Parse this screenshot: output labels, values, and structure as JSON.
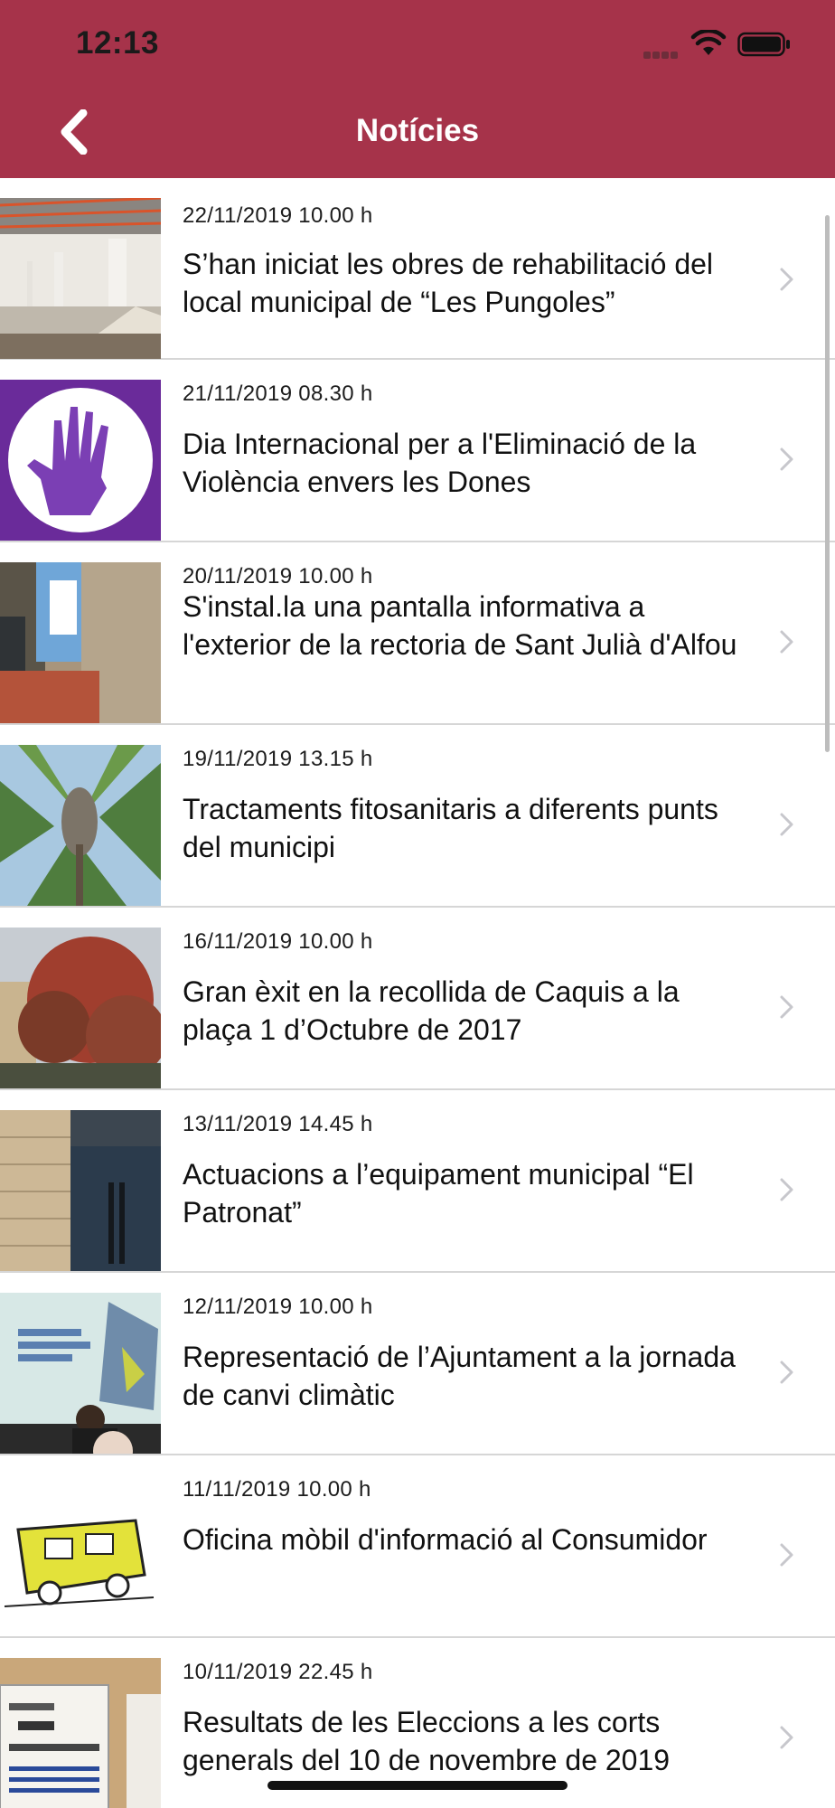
{
  "status_bar": {
    "time": "12:13"
  },
  "header": {
    "title": "Notícies",
    "back_icon": "chevron-left-icon"
  },
  "news": [
    {
      "date": "22/11/2019 10.00 h",
      "title": "S’han iniciat les obres de rehabilitació del local municipal de “Les Pungoles”"
    },
    {
      "date": "21/11/2019 08.30 h",
      "title": "Dia Internacional per a l'Eliminació de la Violència envers les Dones"
    },
    {
      "date": "20/11/2019 10.00 h",
      "title": "S'instal.la una pantalla informativa a l'exterior de la rectoria de Sant Julià d'Alfou"
    },
    {
      "date": "19/11/2019 13.15 h",
      "title": "Tractaments fitosanitaris a diferents punts del municipi"
    },
    {
      "date": "16/11/2019 10.00 h",
      "title": "Gran èxit en la recollida de Caquis a la plaça 1 d’Octubre de 2017"
    },
    {
      "date": "13/11/2019 14.45 h",
      "title": "Actuacions a l’equipament municipal “El Patronat”"
    },
    {
      "date": "12/11/2019 10.00 h",
      "title": "Representació de l’Ajuntament a la jornada de canvi climàtic"
    },
    {
      "date": "11/11/2019 10.00 h",
      "title": "Oficina mòbil d'informació al Consumidor"
    },
    {
      "date": "10/11/2019 22.45 h",
      "title": "Resultats de les Eleccions a les corts generals del 10 de novembre de 2019"
    }
  ],
  "colors": {
    "header": "#a6334a",
    "separator": "#d6d6d6",
    "chevron": "#c7c7cc"
  }
}
